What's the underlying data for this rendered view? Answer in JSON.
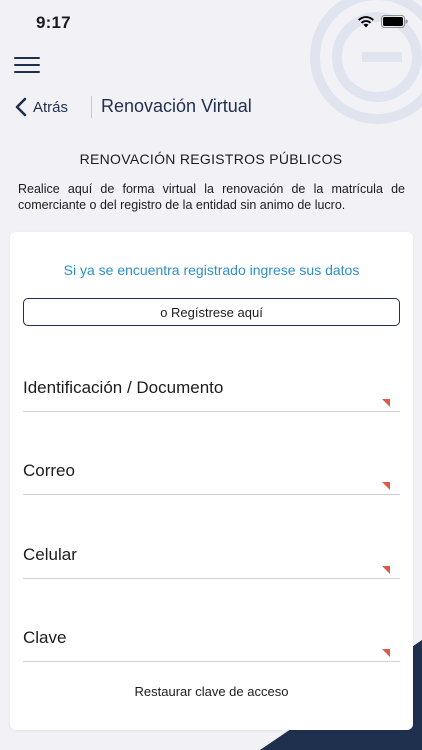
{
  "status_bar": {
    "time": "9:17"
  },
  "nav": {
    "back_label": "Atrás",
    "title": "Renovación Virtual"
  },
  "header": {
    "section_title": "RENOVACIÓN REGISTROS PÚBLICOS",
    "description": "Realice aquí de forma virtual la renovación de la matrícula de comerciante o del registro de la entidad sin animo de lucro."
  },
  "form": {
    "login_prompt": "Si ya se encuentra registrado ingrese sus datos",
    "register_button": "o Regístrese aquí",
    "fields": [
      {
        "label": "Identificación / Documento"
      },
      {
        "label": "Correo"
      },
      {
        "label": "Celular"
      },
      {
        "label": "Clave"
      }
    ],
    "restore_link": "Restaurar clave de acceso"
  },
  "colors": {
    "primary": "#1f2f4e",
    "link": "#2d8fc9",
    "required_marker": "#e05a4a",
    "background": "#f2f2f6"
  }
}
